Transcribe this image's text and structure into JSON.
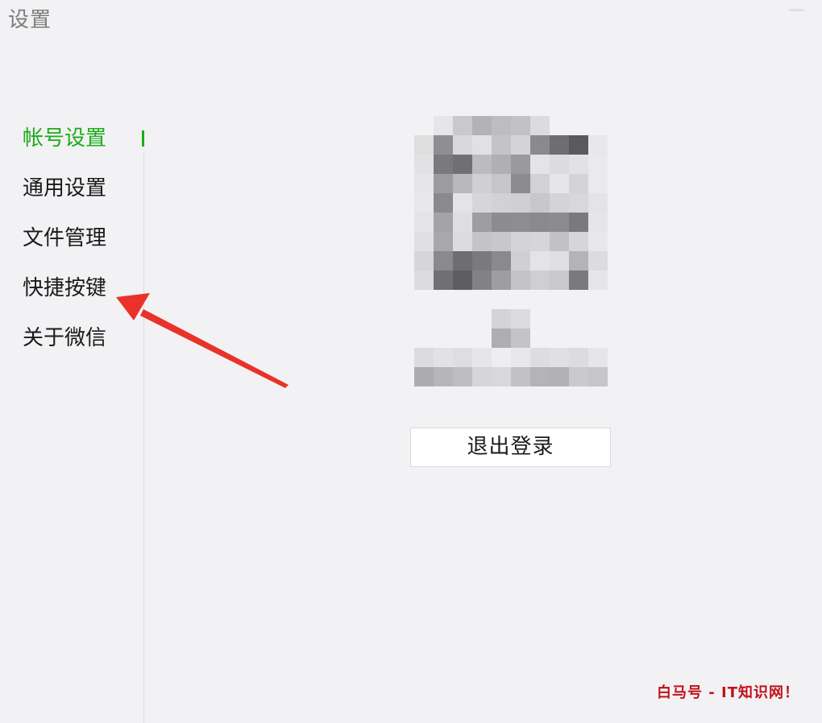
{
  "window": {
    "title": "设置"
  },
  "sidebar": {
    "items": [
      {
        "label": "帐号设置",
        "active": true
      },
      {
        "label": "通用设置",
        "active": false
      },
      {
        "label": "文件管理",
        "active": false
      },
      {
        "label": "快捷按键",
        "active": false
      },
      {
        "label": "关于微信",
        "active": false
      }
    ]
  },
  "account": {
    "logout_label": "退出登录"
  },
  "colors": {
    "accent": "#1aad19",
    "annotation_arrow": "#e8322a",
    "watermark": "#c0121a"
  },
  "watermark": {
    "text": "白马号 - IT知识网！"
  }
}
